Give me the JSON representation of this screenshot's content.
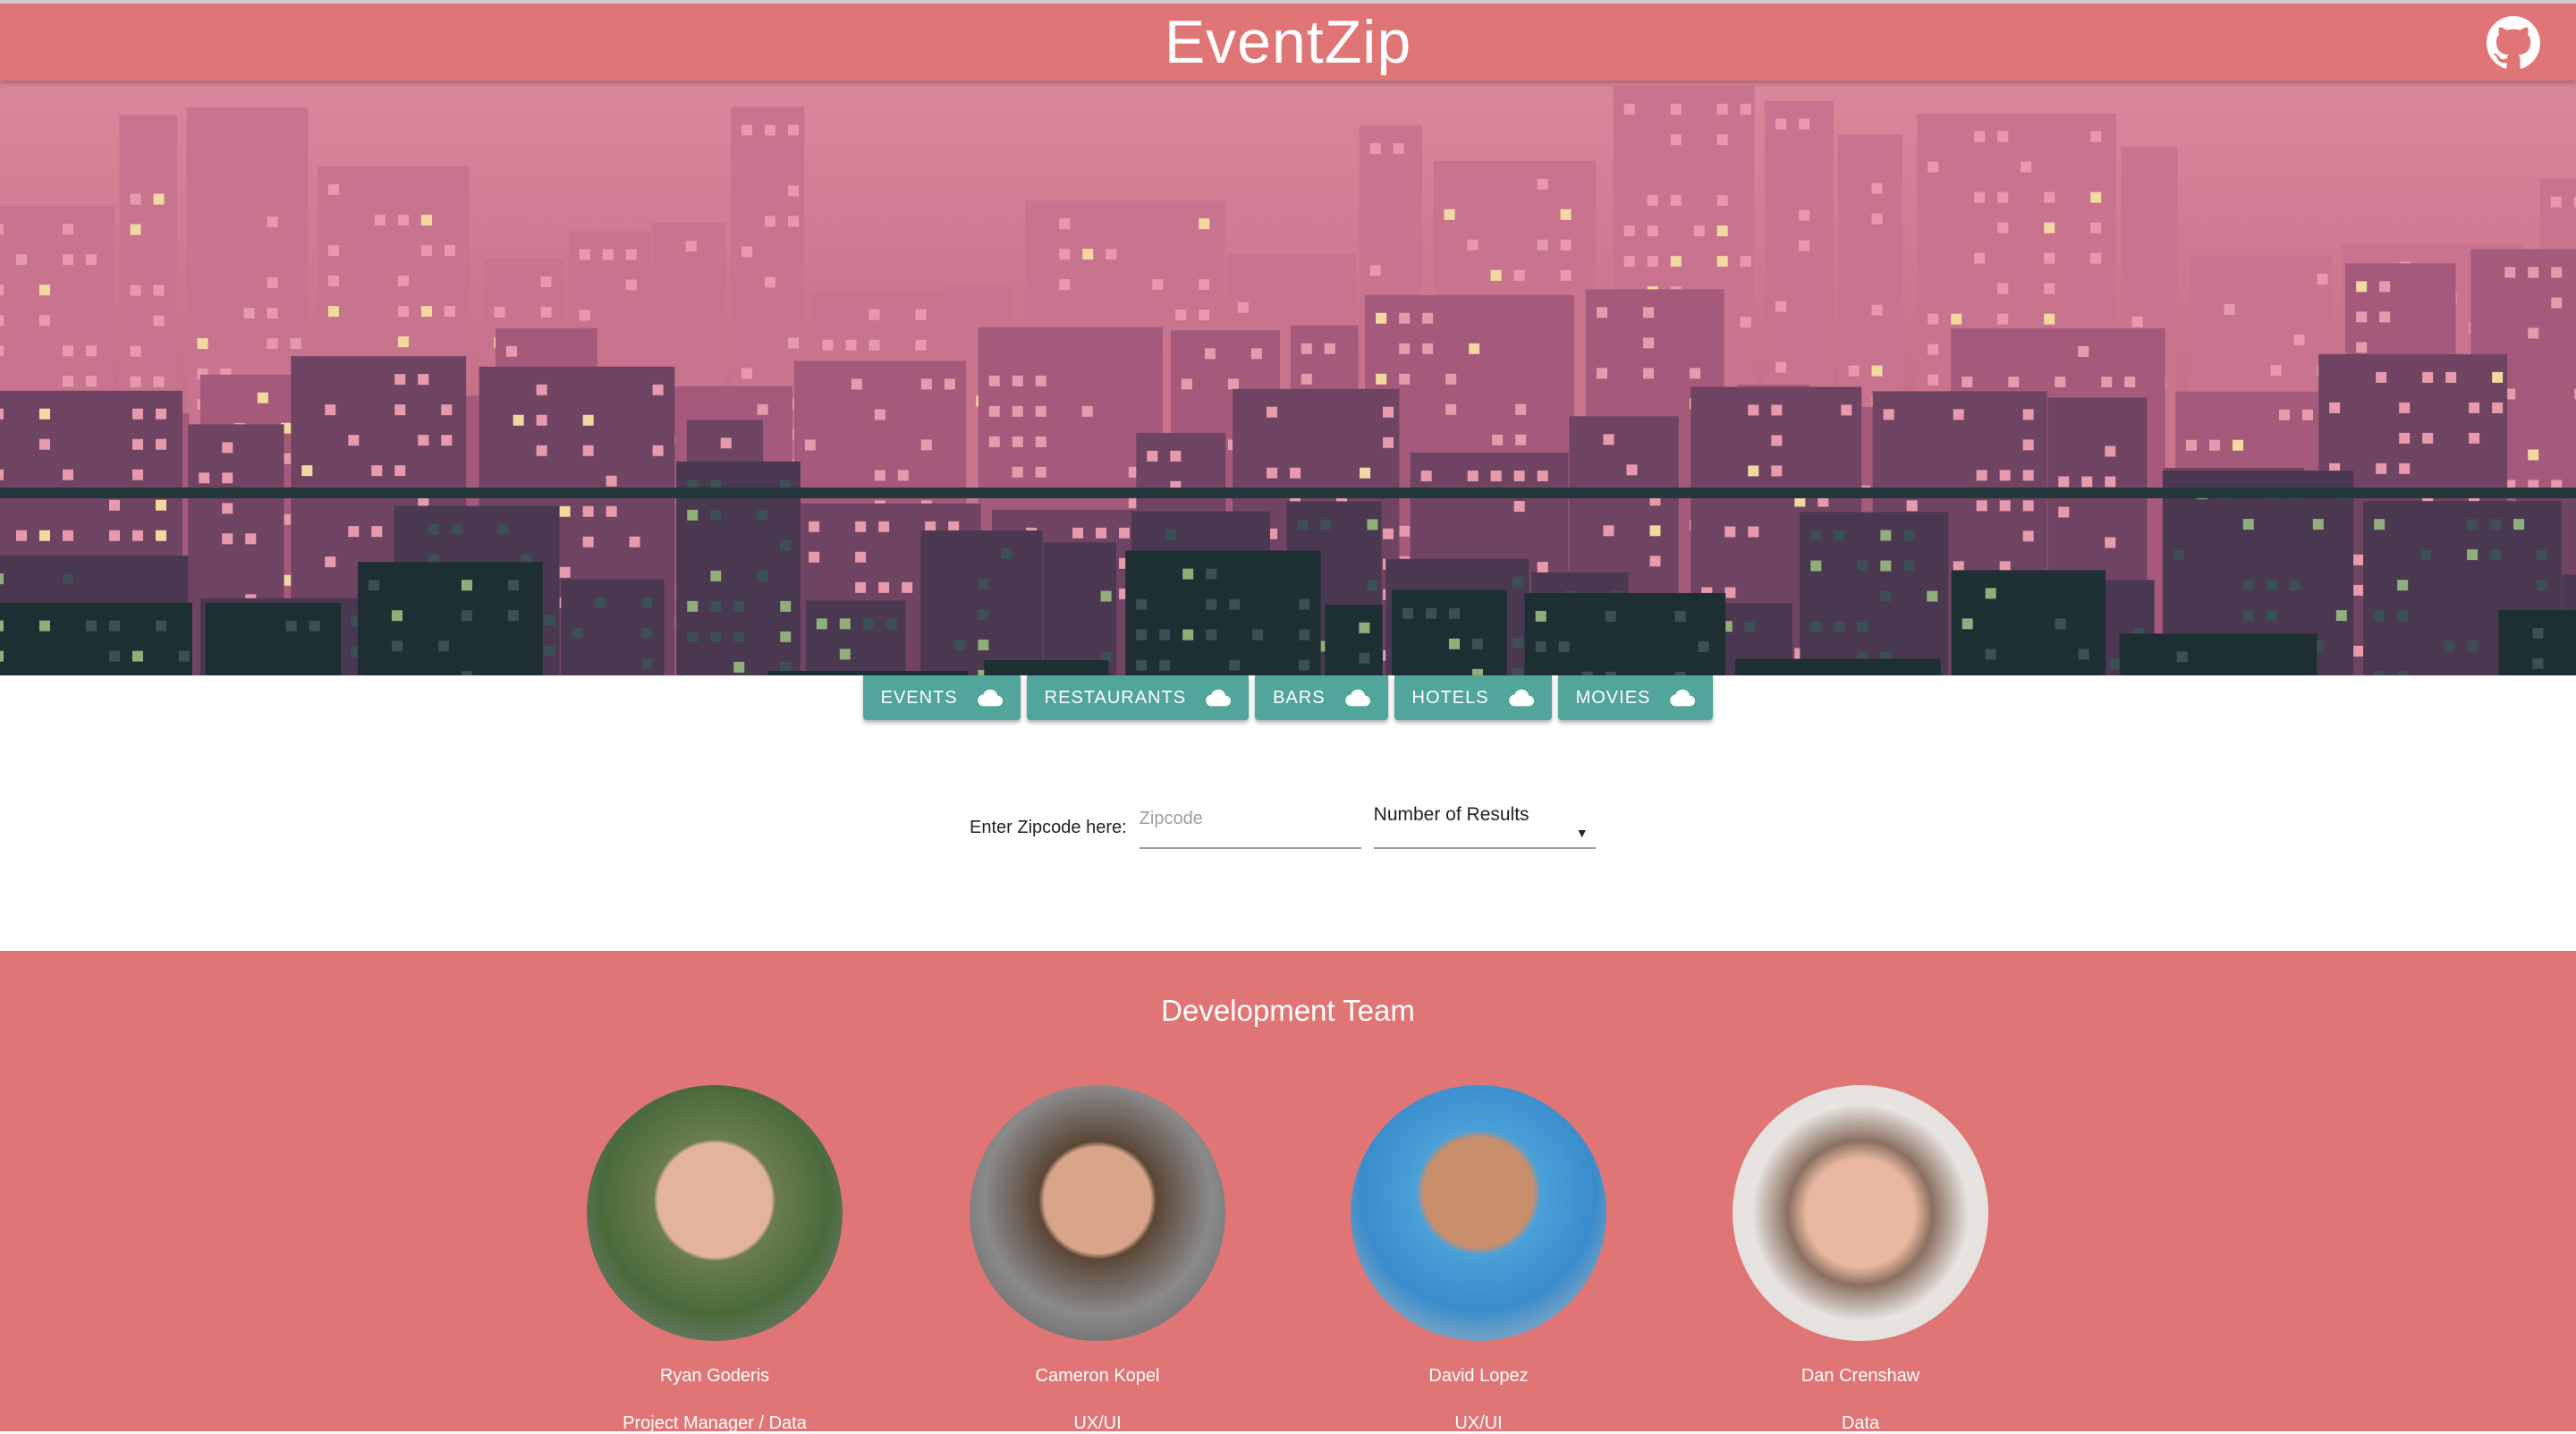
{
  "header": {
    "title": "EventZip",
    "github_icon": "github-icon"
  },
  "tabs": [
    {
      "label": "EVENTS",
      "icon": "cloud-icon"
    },
    {
      "label": "RESTAURANTS",
      "icon": "cloud-icon"
    },
    {
      "label": "BARS",
      "icon": "cloud-icon"
    },
    {
      "label": "HOTELS",
      "icon": "cloud-icon"
    },
    {
      "label": "MOVIES",
      "icon": "cloud-icon"
    }
  ],
  "form": {
    "zip_label": "Enter Zipcode here:",
    "zip_placeholder": "Zipcode",
    "zip_value": "",
    "results_label": "Number of Results"
  },
  "footer": {
    "title": "Development Team",
    "members": [
      {
        "name": "Ryan Goderis",
        "role": "Project Manager / Data"
      },
      {
        "name": "Cameron Kopel",
        "role": "UX/UI"
      },
      {
        "name": "David Lopez",
        "role": "UX/UI"
      },
      {
        "name": "Dan Crenshaw",
        "role": "Data"
      }
    ]
  },
  "colors": {
    "header": "#e07575",
    "tab": "#52a59b",
    "footer": "#e07575"
  }
}
